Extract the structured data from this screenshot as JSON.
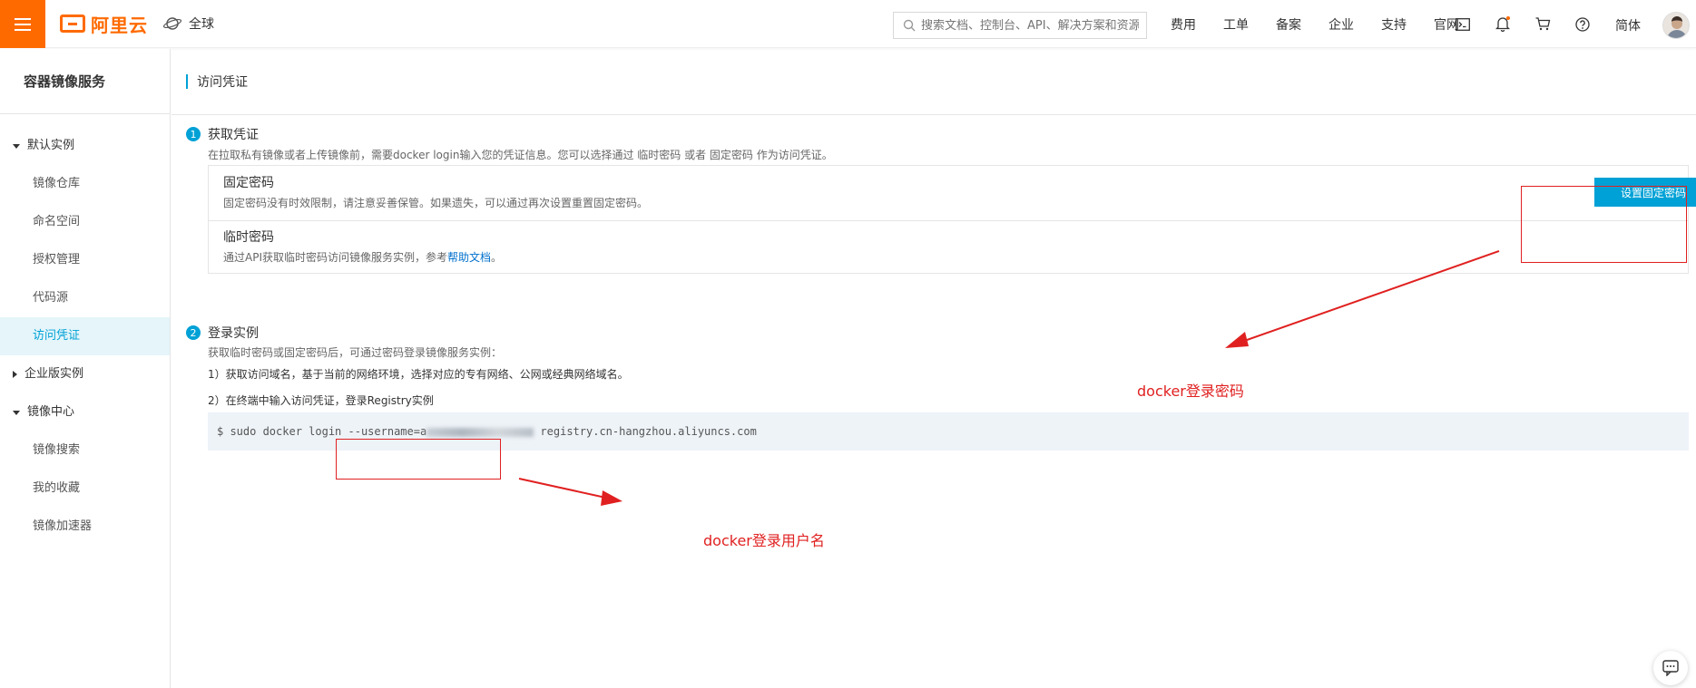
{
  "header": {
    "logo_text": "阿里云",
    "region": "全球",
    "search_placeholder": "搜索文档、控制台、API、解决方案和资源",
    "nav": [
      "费用",
      "工单",
      "备案",
      "企业",
      "支持",
      "官网"
    ],
    "icons": [
      "terminal-icon",
      "bell-icon",
      "cart-icon",
      "help-icon"
    ],
    "lang": "简体",
    "accent": "#ff6a00"
  },
  "sidebar": {
    "title": "容器镜像服务",
    "group1": "默认实例",
    "items1": [
      "镜像仓库",
      "命名空间",
      "授权管理",
      "代码源",
      "访问凭证"
    ],
    "group2": "企业版实例",
    "group3": "镜像中心",
    "items3": [
      "镜像搜索",
      "我的收藏",
      "镜像加速器"
    ],
    "active_color": "#00a1d6"
  },
  "page": {
    "title": "访问凭证",
    "step1": {
      "num": "1",
      "title": "获取凭证",
      "desc": "在拉取私有镜像或者上传镜像前，需要docker login输入您的凭证信息。您可以选择通过 临时密码 或者 固定密码 作为访问凭证。",
      "fixed_title": "固定密码",
      "fixed_desc": "固定密码没有时效限制，请注意妥善保管。如果遗失，可以通过再次设置重置固定密码。",
      "set_button": "设置固定密码",
      "temp_title": "临时密码",
      "temp_desc_prefix": "通过API获取临时密码访问镜像服务实例，参考",
      "temp_desc_link": "帮助文档",
      "temp_desc_suffix": "。"
    },
    "step2": {
      "num": "2",
      "title": "登录实例",
      "desc": "获取临时密码或固定密码后，可通过密码登录镜像服务实例：",
      "line1": "1）获取访问域名，基于当前的网络环境，选择对应的专有网络、公网或经典网络域名。",
      "line2": "2）在终端中输入访问凭证，登录Registry实例",
      "code_prefix": "$ sudo docker login --username=a",
      "code_suffix": "registry.cn-hangzhou.aliyuncs.com"
    }
  },
  "annotations": {
    "password_label": "docker登录密码",
    "username_label": "docker登录用户名",
    "color": "#e02020"
  }
}
